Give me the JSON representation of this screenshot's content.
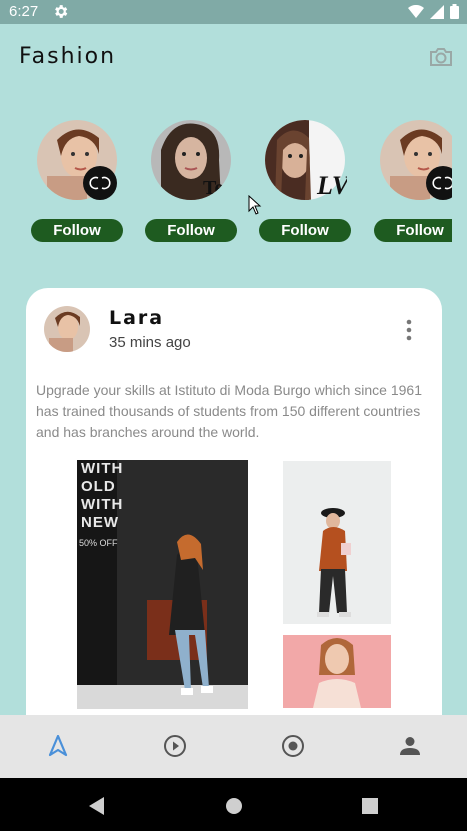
{
  "status_bar": {
    "time": "6:27",
    "icons": [
      "gear-icon",
      "wifi-icon",
      "cellular-icon",
      "battery-icon"
    ]
  },
  "app": {
    "title": "Fashion"
  },
  "stories": [
    {
      "follow_label": "Follow",
      "badge": "chanel-logo"
    },
    {
      "follow_label": "Follow",
      "badge": "none"
    },
    {
      "follow_label": "Follow",
      "badge": "lv-logo"
    },
    {
      "follow_label": "Follow",
      "badge": "chanel-logo"
    }
  ],
  "post": {
    "author": "Lara",
    "time": "35 mins ago",
    "text": "Upgrade your skills at Istituto di Moda Burgo which since 1961 has trained thousands of students from 150 different countries and has branches around the world.",
    "image_text": {
      "line1": "WITH",
      "line2": "OLD",
      "line3": "WITH",
      "line4": "NEW",
      "sale": "50% OFF"
    }
  },
  "bottom_nav": [
    "navigation-icon",
    "play-icon",
    "radio-icon",
    "person-icon"
  ],
  "colors": {
    "background": "#b2dfdb",
    "follow_button": "#1e5b20",
    "accent": "#4a90d9"
  }
}
